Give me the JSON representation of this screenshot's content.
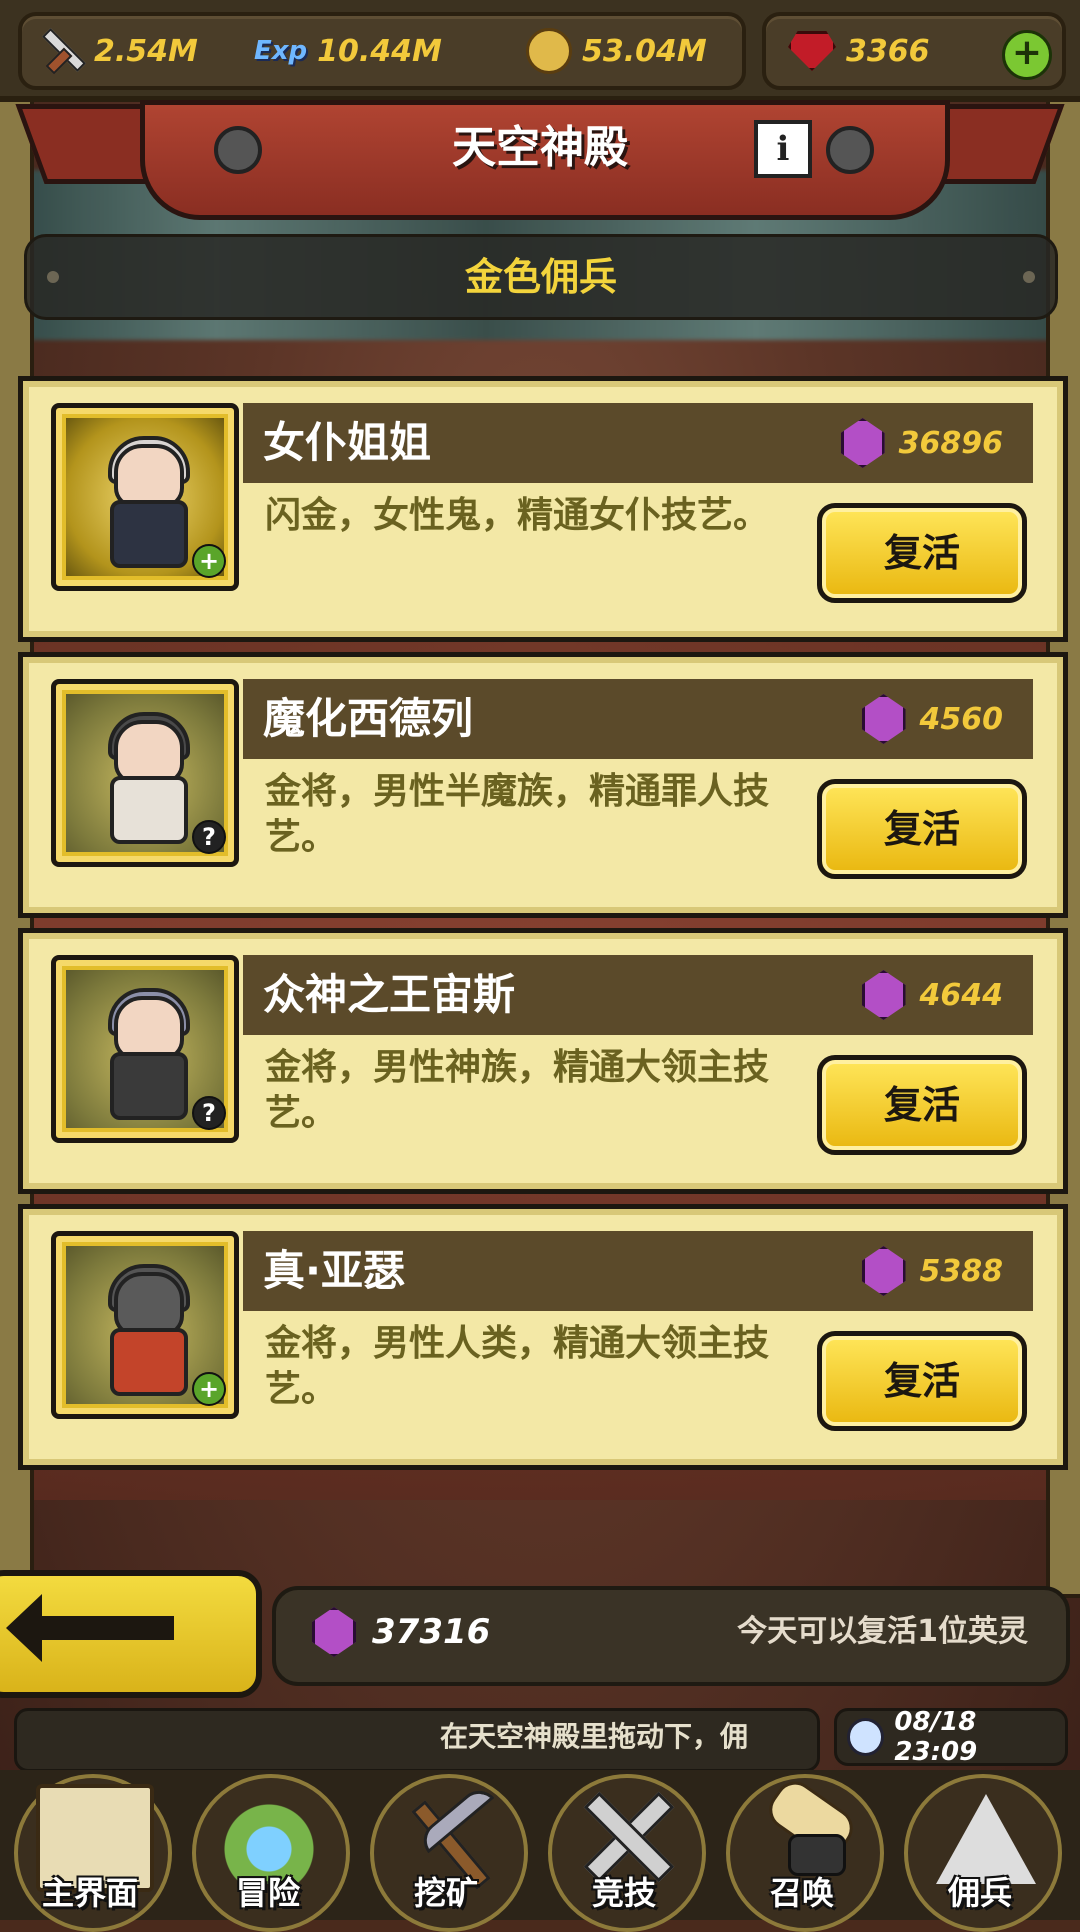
{
  "resources": {
    "attack": "2.54M",
    "exp_icon": "Exp",
    "exp": "10.44M",
    "gold": "53.04M",
    "ruby": "3366",
    "add_label": "+"
  },
  "header": {
    "title": "天空神殿",
    "info_label": "i",
    "subtitle": "金色佣兵"
  },
  "heroes": [
    {
      "name": "女仆姐姐",
      "cost": "36896",
      "desc": "闪金，女性鬼，精通女仆技艺。",
      "badge": "+",
      "button": "复活"
    },
    {
      "name": "魔化西德列",
      "cost": "4560",
      "desc": "金将，男性半魔族，精通罪人技艺。",
      "badge": "?",
      "button": "复活"
    },
    {
      "name": "众神之王宙斯",
      "cost": "4644",
      "desc": "金将，男性神族，精通大领主技艺。",
      "badge": "?",
      "button": "复活"
    },
    {
      "name": "真·亚瑟",
      "cost": "5388",
      "desc": "金将，男性人类，精通大领主技艺。",
      "badge": "+",
      "button": "复活"
    }
  ],
  "footer": {
    "total_gems": "37316",
    "today_text": "今天可以复活1位英灵",
    "ticker": "在天空神殿里拖动下，佣",
    "datetime": "08/18 23:09"
  },
  "nav": [
    {
      "label": "主界面",
      "icon": "map-scroll-icon"
    },
    {
      "label": "冒险",
      "icon": "island-icon"
    },
    {
      "label": "挖矿",
      "icon": "pickaxe-icon"
    },
    {
      "label": "竞技",
      "icon": "crossed-swords-icon"
    },
    {
      "label": "召唤",
      "icon": "summon-scroll-icon"
    },
    {
      "label": "佣兵",
      "icon": "tent-icon"
    }
  ],
  "colors": {
    "accent_gold": "#f2c93b",
    "card_bg": "#f3e8a6",
    "button_yellow": "#ffe65a",
    "gem_purple": "#b34fc6"
  }
}
